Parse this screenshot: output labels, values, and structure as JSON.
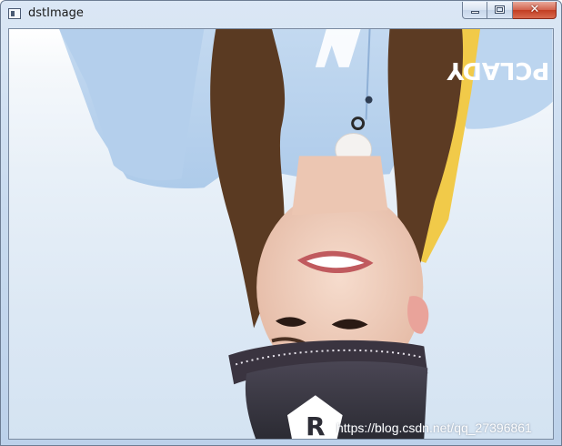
{
  "window": {
    "title": "dstImage",
    "close_glyph": "✕",
    "icons": {
      "app": "window-app-icon",
      "minimize": "minimize-icon",
      "maximize": "maximize-icon",
      "close": "close-icon"
    }
  },
  "image": {
    "orientation": "upside-down",
    "logo_text": "PCLADY",
    "cap_badge_text": "R",
    "watermark": "https://blog.csdn.net/qq_27396861"
  },
  "colors": {
    "shirt": "#b9d3ee",
    "ribbon": "#f2cc4a",
    "hair": "#5a3a22",
    "skin": "#f1d3c2",
    "cap": "#3b3b44",
    "close_button": "#c8432a"
  }
}
